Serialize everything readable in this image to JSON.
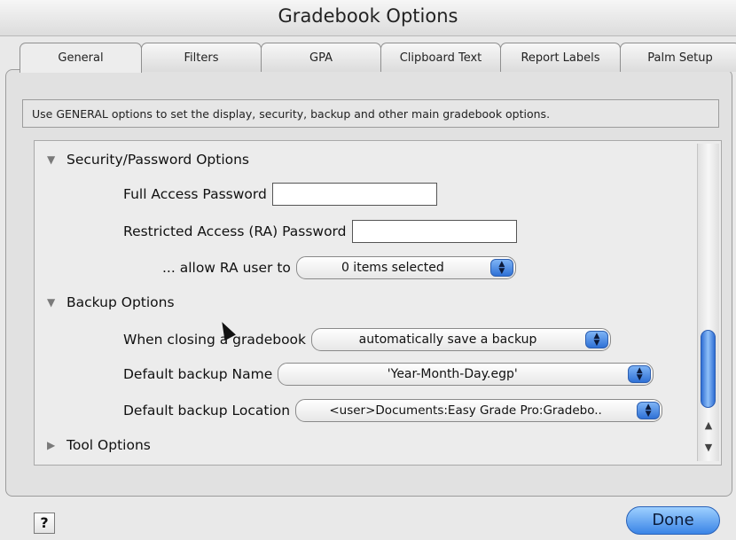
{
  "window": {
    "title": "Gradebook Options"
  },
  "tabs": [
    {
      "label": "General"
    },
    {
      "label": "Filters"
    },
    {
      "label": "GPA"
    },
    {
      "label": "Clipboard Text"
    },
    {
      "label": "Report Labels"
    },
    {
      "label": "Palm Setup"
    }
  ],
  "description": "Use GENERAL options to set the display, security, backup and other main gradebook options.",
  "security": {
    "heading": "Security/Password Options",
    "full_label": "Full Access Password",
    "full_value": "",
    "ra_label": "Restricted Access (RA) Password",
    "ra_value": "",
    "allow_label": "... allow RA user to",
    "allow_value": "0 items selected"
  },
  "backup": {
    "heading": "Backup Options",
    "closing_label": "When closing a gradebook",
    "closing_value": "automatically save a backup",
    "name_label": "Default backup Name",
    "name_value": "'Year-Month-Day.egp'",
    "location_label": "Default backup Location",
    "location_value": "<user>Documents:Easy Grade Pro:Gradebo.."
  },
  "tool": {
    "heading": "Tool Options"
  },
  "footer": {
    "help": "?",
    "done": "Done"
  }
}
